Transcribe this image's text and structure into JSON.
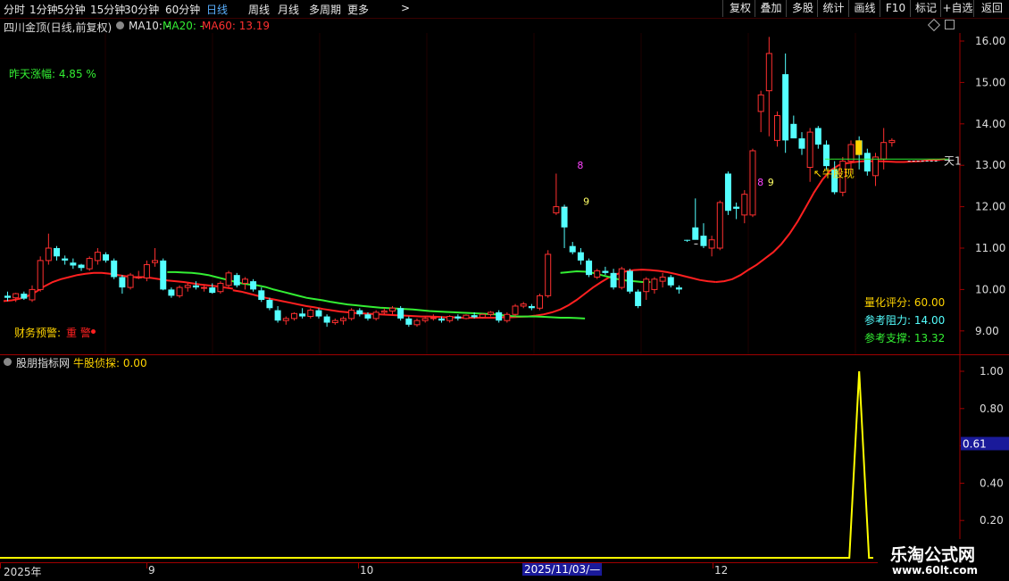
{
  "toolbar": {
    "timeframes": [
      {
        "label": "分时",
        "active": false
      },
      {
        "label": "1分钟",
        "active": false
      },
      {
        "label": "5分钟",
        "active": false
      },
      {
        "label": "15分钟",
        "active": false
      },
      {
        "label": "30分钟",
        "active": false
      },
      {
        "label": "60分钟",
        "active": false
      },
      {
        "label": "日线",
        "active": true
      },
      {
        "label": "周线",
        "active": false
      },
      {
        "label": "月线",
        "active": false
      },
      {
        "label": "多周期",
        "active": false
      },
      {
        "label": "更多",
        "active": false
      }
    ],
    "more_arrow": ">",
    "buttons": [
      "复权",
      "叠加",
      "多股",
      "统计",
      "画线",
      "F10",
      "标记",
      "+自选",
      "返回"
    ]
  },
  "main": {
    "stock_title": "四川金顶(日线,前复权)",
    "ma10_label": "MA10: -",
    "ma20_label": "MA20: -",
    "ma60_label": "MA60: 13.19",
    "yesterday_label": "昨天涨幅: 4.85 %",
    "finance_warning": "财务预警:",
    "finance_badge": "重 警",
    "score_label": "量化评分: 60.00",
    "resistance_label": "参考阻力: 14.00",
    "support_label": "参考支撑: 13.32",
    "annot_8a": "8",
    "annot_9a": "9",
    "annot_8b": "8",
    "annot_9b": "9",
    "bull_label": "↖牛股现",
    "tian_label": "天1",
    "price_axis": [
      "16.00",
      "15.00",
      "14.00",
      "13.00",
      "12.00",
      "11.00",
      "10.00",
      "9.00"
    ]
  },
  "sub": {
    "indicator_title": "股朋指标网",
    "indicator_value": "牛股侦探: 0.00",
    "axis": [
      "1.00",
      "0.80",
      "0.60",
      "0.40",
      "0.20"
    ],
    "cursor_value": "0.61"
  },
  "time_axis": {
    "labels": [
      "2025年",
      "9",
      "10",
      "2025/11/03/—",
      "12"
    ]
  },
  "watermark": {
    "name": "乐淘公式网",
    "url": "www.60lt.com"
  },
  "colors": {
    "up": "#ff3030",
    "down": "#54ffff",
    "ma_red": "#ff2020",
    "ma_green": "#33ee33",
    "indicator": "#ffff00",
    "axis_red": "#a00000",
    "active_tab": "#5ab0ff"
  },
  "chart_data": {
    "type": "candlestick",
    "price_range": [
      8.5,
      16.5
    ],
    "candles": [
      [
        9.85,
        9.95,
        9.72,
        9.8
      ],
      [
        9.8,
        9.92,
        9.7,
        9.9
      ],
      [
        9.9,
        9.95,
        9.75,
        9.78
      ],
      [
        9.75,
        10.1,
        9.7,
        10.0
      ],
      [
        10.0,
        10.8,
        9.95,
        10.7
      ],
      [
        10.7,
        11.35,
        10.6,
        11.0
      ],
      [
        11.0,
        11.05,
        10.7,
        10.8
      ],
      [
        10.75,
        10.82,
        10.6,
        10.7
      ],
      [
        10.65,
        10.75,
        10.5,
        10.58
      ],
      [
        10.6,
        10.62,
        10.45,
        10.52
      ],
      [
        10.5,
        10.8,
        10.45,
        10.75
      ],
      [
        10.7,
        11.0,
        10.6,
        10.9
      ],
      [
        10.85,
        10.9,
        10.65,
        10.7
      ],
      [
        10.7,
        10.75,
        10.25,
        10.3
      ],
      [
        10.3,
        10.35,
        9.9,
        10.05
      ],
      [
        10.05,
        10.4,
        10.0,
        10.35
      ],
      [
        10.3,
        10.45,
        10.25,
        10.3
      ],
      [
        10.28,
        10.7,
        10.2,
        10.6
      ],
      [
        10.65,
        11.0,
        10.55,
        10.7
      ],
      [
        10.7,
        10.75,
        9.98,
        10.0
      ],
      [
        10.0,
        10.05,
        9.8,
        9.85
      ],
      [
        9.85,
        10.1,
        9.8,
        10.05
      ],
      [
        10.05,
        10.15,
        9.95,
        10.1
      ],
      [
        10.1,
        10.2,
        10.0,
        10.05
      ],
      [
        10.05,
        10.1,
        9.95,
        10.05
      ],
      [
        10.05,
        10.15,
        9.9,
        9.92
      ],
      [
        9.95,
        10.2,
        9.9,
        10.15
      ],
      [
        10.1,
        10.45,
        10.05,
        10.4
      ],
      [
        10.35,
        10.4,
        10.05,
        10.1
      ],
      [
        10.15,
        10.3,
        10.0,
        10.25
      ],
      [
        10.2,
        10.25,
        9.95,
        10.0
      ],
      [
        9.98,
        10.05,
        9.7,
        9.75
      ],
      [
        9.75,
        9.8,
        9.5,
        9.55
      ],
      [
        9.5,
        9.6,
        9.2,
        9.25
      ],
      [
        9.25,
        9.35,
        9.15,
        9.3
      ],
      [
        9.3,
        9.45,
        9.25,
        9.42
      ],
      [
        9.42,
        9.55,
        9.3,
        9.35
      ],
      [
        9.35,
        9.55,
        9.3,
        9.5
      ],
      [
        9.5,
        9.55,
        9.3,
        9.35
      ],
      [
        9.35,
        9.4,
        9.1,
        9.2
      ],
      [
        9.2,
        9.3,
        9.15,
        9.25
      ],
      [
        9.25,
        9.35,
        9.15,
        9.3
      ],
      [
        9.3,
        9.55,
        9.25,
        9.5
      ],
      [
        9.5,
        9.55,
        9.35,
        9.4
      ],
      [
        9.4,
        9.45,
        9.25,
        9.3
      ],
      [
        9.3,
        9.5,
        9.25,
        9.45
      ],
      [
        9.45,
        9.55,
        9.4,
        9.48
      ],
      [
        9.48,
        9.6,
        9.4,
        9.55
      ],
      [
        9.55,
        9.6,
        9.25,
        9.3
      ],
      [
        9.3,
        9.35,
        9.1,
        9.15
      ],
      [
        9.15,
        9.3,
        9.1,
        9.25
      ],
      [
        9.25,
        9.35,
        9.2,
        9.3
      ],
      [
        9.3,
        9.4,
        9.25,
        9.32
      ],
      [
        9.3,
        9.35,
        9.2,
        9.25
      ],
      [
        9.25,
        9.38,
        9.2,
        9.35
      ],
      [
        9.35,
        9.4,
        9.25,
        9.3
      ],
      [
        9.3,
        9.4,
        9.28,
        9.38
      ],
      [
        9.38,
        9.45,
        9.3,
        9.33
      ],
      [
        9.33,
        9.42,
        9.3,
        9.4
      ],
      [
        9.4,
        9.48,
        9.35,
        9.45
      ],
      [
        9.45,
        9.5,
        9.2,
        9.25
      ],
      [
        9.25,
        9.45,
        9.2,
        9.4
      ],
      [
        9.4,
        9.65,
        9.35,
        9.6
      ],
      [
        9.6,
        9.7,
        9.55,
        9.65
      ],
      [
        9.6,
        9.65,
        9.5,
        9.55
      ],
      [
        9.55,
        9.9,
        9.5,
        9.85
      ],
      [
        9.85,
        10.95,
        9.8,
        10.85
      ],
      [
        11.85,
        12.8,
        11.8,
        12.0
      ],
      [
        12.0,
        12.05,
        11.0,
        11.5
      ],
      [
        11.05,
        11.15,
        10.85,
        10.9
      ],
      [
        10.9,
        11.0,
        10.6,
        10.7
      ],
      [
        10.7,
        10.75,
        10.3,
        10.35
      ],
      [
        10.3,
        10.5,
        10.25,
        10.45
      ],
      [
        10.45,
        10.55,
        10.35,
        10.4
      ],
      [
        10.4,
        10.5,
        10.0,
        10.05
      ],
      [
        10.05,
        10.55,
        10.0,
        10.5
      ],
      [
        10.45,
        10.5,
        9.9,
        9.95
      ],
      [
        9.95,
        10.0,
        9.55,
        9.6
      ],
      [
        9.95,
        10.3,
        9.75,
        10.25
      ],
      [
        10.0,
        10.3,
        9.9,
        10.25
      ],
      [
        10.2,
        10.4,
        10.05,
        10.3
      ],
      [
        10.3,
        10.35,
        10.05,
        10.1
      ],
      [
        10.05,
        10.1,
        9.9,
        10.0
      ],
      [
        11.2,
        11.2,
        11.15,
        11.18
      ],
      [
        11.5,
        12.2,
        11.3,
        11.2
      ],
      [
        11.3,
        11.6,
        11.0,
        11.05
      ],
      [
        11.0,
        11.3,
        10.8,
        11.2
      ],
      [
        11.0,
        12.15,
        10.95,
        12.1
      ],
      [
        12.8,
        12.85,
        11.8,
        11.9
      ],
      [
        12.0,
        12.1,
        11.7,
        11.95
      ],
      [
        11.8,
        12.4,
        11.6,
        12.3
      ],
      [
        11.8,
        13.4,
        11.75,
        13.35
      ],
      [
        14.3,
        14.8,
        13.8,
        14.7
      ],
      [
        14.8,
        16.1,
        13.7,
        15.7
      ],
      [
        13.6,
        14.3,
        13.45,
        14.2
      ],
      [
        15.2,
        15.7,
        13.3,
        13.6
      ],
      [
        14.0,
        14.2,
        13.65,
        13.65
      ],
      [
        13.65,
        13.8,
        13.25,
        13.4
      ],
      [
        12.95,
        13.9,
        12.6,
        13.8
      ],
      [
        13.9,
        13.95,
        13.4,
        13.5
      ],
      [
        13.5,
        13.6,
        12.9,
        12.98
      ],
      [
        12.9,
        13.1,
        12.3,
        12.35
      ],
      [
        12.35,
        13.2,
        12.25,
        13.1
      ],
      [
        13.1,
        13.6,
        12.8,
        13.5
      ],
      [
        13.6,
        13.7,
        12.9,
        13.25
      ],
      [
        13.3,
        13.4,
        12.75,
        12.85
      ],
      [
        12.75,
        13.3,
        12.5,
        13.2
      ],
      [
        13.15,
        13.9,
        12.9,
        13.55
      ],
      [
        13.55,
        13.65,
        13.45,
        13.6
      ]
    ],
    "ma_red": [
      [
        9.72,
        9.74,
        9.78,
        9.85,
        9.95,
        10.08,
        10.18,
        10.25,
        10.3,
        10.35,
        10.38,
        10.4,
        10.4,
        10.38,
        10.35,
        10.32,
        10.3,
        10.3,
        10.28,
        10.25,
        10.22,
        10.2,
        10.18,
        10.15,
        10.12,
        10.1,
        10.08,
        10.05,
        10.02
      ],
      [
        9.98,
        9.95,
        9.9,
        9.85,
        9.8,
        9.76,
        9.72,
        9.68,
        9.64,
        9.6,
        9.57,
        9.53,
        9.5,
        9.47,
        9.45,
        9.43,
        9.42,
        9.41,
        9.4,
        9.39,
        9.38,
        9.37,
        9.36,
        9.35,
        9.35,
        9.34,
        9.33,
        9.33,
        9.32,
        9.32
      ],
      [
        9.32,
        9.32,
        9.32,
        9.32,
        9.33,
        9.33,
        9.34,
        9.35,
        9.37,
        9.4,
        9.45,
        9.52,
        9.62,
        9.75,
        9.9,
        10.05,
        10.18,
        10.3,
        10.38,
        10.44,
        10.47,
        10.48,
        10.47,
        10.45,
        10.42,
        10.38,
        10.33,
        10.28,
        10.23,
        10.2,
        10.18
      ],
      [
        10.18,
        10.2,
        10.25,
        10.35,
        10.48,
        10.6,
        10.75,
        10.9,
        11.1,
        11.35,
        11.65,
        12.0,
        12.35,
        12.65,
        12.88,
        13.0,
        13.05,
        13.08,
        13.1,
        13.1,
        13.1,
        13.09,
        13.08,
        13.08,
        13.09,
        13.1,
        13.12,
        13.13,
        13.15
      ]
    ],
    "ma_green_segments": [
      [
        [
          10.42,
          10.42,
          10.41,
          10.4,
          10.38,
          10.35,
          10.3,
          10.25,
          10.2,
          10.15,
          10.12,
          10.1,
          10.06,
          10.0,
          9.95,
          9.9,
          9.85,
          9.8,
          9.77,
          9.74,
          9.7,
          9.67,
          9.64,
          9.62,
          9.6,
          9.58,
          9.56,
          9.55,
          9.54,
          9.53,
          9.52,
          9.5,
          9.48,
          9.47,
          9.46,
          9.45,
          9.44,
          9.43,
          9.42,
          9.41,
          9.4,
          9.38,
          9.36,
          9.35,
          9.35,
          9.35,
          9.34,
          9.33,
          9.32,
          9.32,
          9.31,
          9.3
        ],
        20
      ],
      [
        [
          10.4,
          10.42,
          10.44,
          10.43,
          10.4,
          10.35,
          10.3,
          10.25,
          10.22,
          10.2,
          10.18,
          10.18
        ],
        68
      ]
    ],
    "indicator": {
      "name": "牛股侦探",
      "spike_index": 104,
      "spike_value": 1.0,
      "base_value": 0.0,
      "range": [
        0,
        1.05
      ]
    }
  }
}
